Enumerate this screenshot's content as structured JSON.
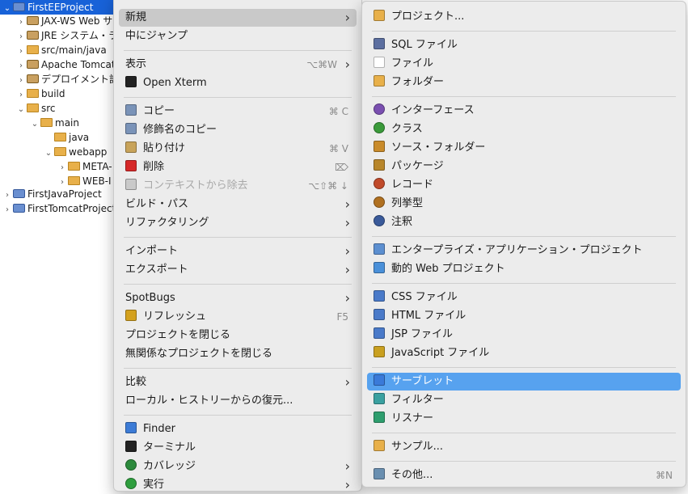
{
  "tree": [
    {
      "label": "FirstEEProject",
      "chev": "v",
      "indent": 0,
      "icon": "project",
      "selected": true
    },
    {
      "label": "JAX-WS Web サ",
      "chev": ">",
      "indent": 1,
      "icon": "lib"
    },
    {
      "label": "JRE システム・ラ",
      "chev": ">",
      "indent": 1,
      "icon": "lib"
    },
    {
      "label": "src/main/java",
      "chev": ">",
      "indent": 1,
      "icon": "folder"
    },
    {
      "label": "Apache Tomcat",
      "chev": ">",
      "indent": 1,
      "icon": "lib"
    },
    {
      "label": "デプロイメント記",
      "chev": ">",
      "indent": 1,
      "icon": "lib"
    },
    {
      "label": "build",
      "chev": ">",
      "indent": 1,
      "icon": "folder"
    },
    {
      "label": "src",
      "chev": "v",
      "indent": 1,
      "icon": "folder"
    },
    {
      "label": "main",
      "chev": "v",
      "indent": 2,
      "icon": "folder"
    },
    {
      "label": "java",
      "chev": "",
      "indent": 3,
      "icon": "folder"
    },
    {
      "label": "webapp",
      "chev": "v",
      "indent": 3,
      "icon": "folder"
    },
    {
      "label": "META-",
      "chev": ">",
      "indent": 4,
      "icon": "folder"
    },
    {
      "label": "WEB-I",
      "chev": ">",
      "indent": 4,
      "icon": "folder"
    },
    {
      "label": "FirstJavaProject",
      "chev": ">",
      "indent": 0,
      "icon": "project"
    },
    {
      "label": "FirstTomcatProject",
      "chev": ">",
      "indent": 0,
      "icon": "project"
    }
  ],
  "context_menu": [
    {
      "label": "新規",
      "submenu": true,
      "highlight": true
    },
    {
      "label": "中にジャンプ"
    },
    {
      "sep": true
    },
    {
      "label": "表示",
      "shortcut": "⌥⌘W",
      "submenu": true
    },
    {
      "label": "Open Xterm",
      "icon": "terminal-icon"
    },
    {
      "sep": true
    },
    {
      "label": "コピー",
      "shortcut": "⌘ C",
      "icon": "copy-icon"
    },
    {
      "label": "修飾名のコピー",
      "icon": "copy-qualified-icon"
    },
    {
      "label": "貼り付け",
      "shortcut": "⌘ V",
      "icon": "paste-icon"
    },
    {
      "label": "削除",
      "shortcut": "⌦",
      "icon": "delete-icon"
    },
    {
      "label": "コンテキストから除去",
      "shortcut": "⌥⇧⌘ ↓",
      "icon": "remove-context-icon",
      "disabled": true
    },
    {
      "label": "ビルド・パス",
      "submenu": true
    },
    {
      "label": "リファクタリング",
      "submenu": true
    },
    {
      "sep": true
    },
    {
      "label": "インポート",
      "submenu": true
    },
    {
      "label": "エクスポート",
      "submenu": true
    },
    {
      "sep": true
    },
    {
      "label": "SpotBugs",
      "submenu": true
    },
    {
      "label": "リフレッシュ",
      "shortcut": "F5",
      "icon": "refresh-icon"
    },
    {
      "label": "プロジェクトを閉じる"
    },
    {
      "label": "無関係なプロジェクトを閉じる"
    },
    {
      "sep": true
    },
    {
      "label": "比較",
      "submenu": true
    },
    {
      "label": "ローカル・ヒストリーからの復元..."
    },
    {
      "sep": true
    },
    {
      "label": "Finder",
      "icon": "finder-icon"
    },
    {
      "label": "ターミナル",
      "icon": "terminal-window-icon"
    },
    {
      "label": "カバレッジ",
      "submenu": true,
      "icon": "coverage-icon"
    },
    {
      "label": "実行",
      "submenu": true,
      "icon": "run-icon"
    }
  ],
  "new_submenu": [
    {
      "label": "プロジェクト...",
      "icon": "new-project-icon"
    },
    {
      "sep": true
    },
    {
      "label": "SQL ファイル",
      "icon": "sql-file-icon"
    },
    {
      "label": "ファイル",
      "icon": "file-icon"
    },
    {
      "label": "フォルダー",
      "icon": "folder-icon"
    },
    {
      "sep": true
    },
    {
      "label": "インターフェース",
      "icon": "interface-icon"
    },
    {
      "label": "クラス",
      "icon": "class-icon"
    },
    {
      "label": "ソース・フォルダー",
      "icon": "source-folder-icon"
    },
    {
      "label": "パッケージ",
      "icon": "package-icon"
    },
    {
      "label": "レコード",
      "icon": "record-icon"
    },
    {
      "label": "列挙型",
      "icon": "enum-icon"
    },
    {
      "label": "注釈",
      "icon": "annotation-icon"
    },
    {
      "sep": true
    },
    {
      "label": "エンタープライズ・アプリケーション・プロジェクト",
      "icon": "ear-project-icon"
    },
    {
      "label": "動的 Web プロジェクト",
      "icon": "web-project-icon"
    },
    {
      "sep": true
    },
    {
      "label": "CSS ファイル",
      "icon": "css-file-icon"
    },
    {
      "label": "HTML ファイル",
      "icon": "html-file-icon"
    },
    {
      "label": "JSP ファイル",
      "icon": "jsp-file-icon"
    },
    {
      "label": "JavaScript ファイル",
      "icon": "javascript-file-icon"
    },
    {
      "sep": true
    },
    {
      "label": "サーブレット",
      "icon": "servlet-icon",
      "highlight": true
    },
    {
      "label": "フィルター",
      "icon": "filter-icon"
    },
    {
      "label": "リスナー",
      "icon": "listener-icon"
    },
    {
      "sep": true
    },
    {
      "label": "サンプル...",
      "icon": "sample-icon"
    },
    {
      "sep": true
    },
    {
      "label": "その他...",
      "shortcut": "⌘N",
      "icon": "other-icon"
    }
  ],
  "colors": {
    "selection": "#1862d8",
    "submenu_highlight": "#57a2ef",
    "menu_bg": "#ececec"
  }
}
